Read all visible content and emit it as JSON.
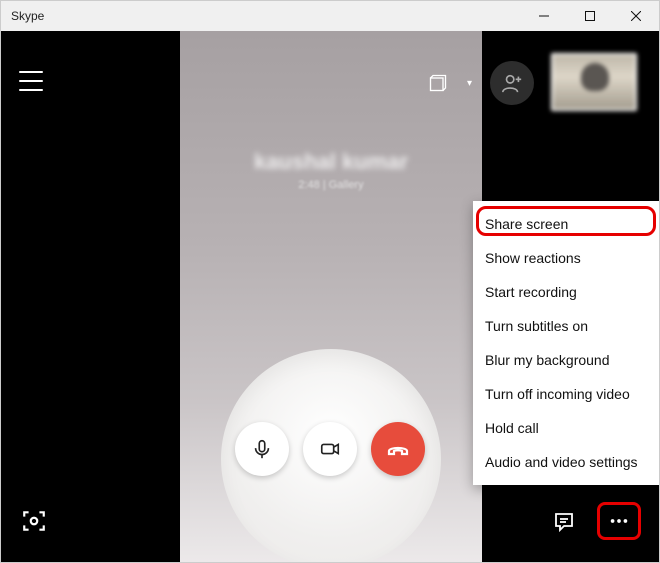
{
  "window": {
    "title": "Skype"
  },
  "call": {
    "peer_name": "kaushal kumar",
    "sub_line": "2:48  |  Gallery"
  },
  "menu": {
    "items": [
      "Share screen",
      "Show reactions",
      "Start recording",
      "Turn subtitles on",
      "Blur my background",
      "Turn off incoming video",
      "Hold call",
      "Audio and video settings"
    ]
  }
}
